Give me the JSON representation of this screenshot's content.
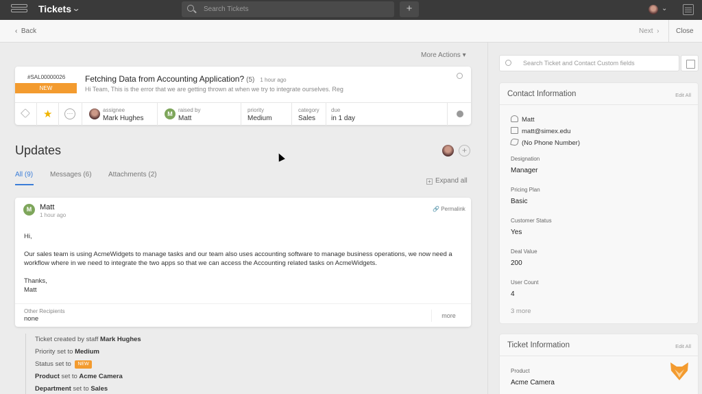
{
  "topbar": {
    "title": "Tickets",
    "search_placeholder": "Search Tickets",
    "add_label": "+"
  },
  "subnav": {
    "back": "Back",
    "next": "Next",
    "close": "Close"
  },
  "more_actions": "More Actions",
  "ticket": {
    "id": "#SAL00000026",
    "status": "NEW",
    "title": "Fetching Data from Accounting Application?",
    "count": "(5)",
    "time": "1 hour ago",
    "preview": "Hi Team, This is the error that we are getting thrown at when we try to integrate ourselves. Reg",
    "meta": {
      "assignee_label": "assignee",
      "assignee": "Mark Hughes",
      "raised_label": "raised by",
      "raised_initial": "M",
      "raised": "Matt",
      "priority_label": "priority",
      "priority": "Medium",
      "category_label": "category",
      "category": "Sales",
      "due_label": "due",
      "due": "in 1 day"
    }
  },
  "updates": {
    "title": "Updates",
    "tabs": [
      "All (9)",
      "Messages (6)",
      "Attachments (2)"
    ],
    "expand_all": "Expand all"
  },
  "message": {
    "initial": "M",
    "author": "Matt",
    "time": "1 hour ago",
    "permalink": "Permalink",
    "greeting": "Hi,",
    "body": "Our sales team is using AcmeWidgets to manage tasks and our team also uses accounting software to manage business operations, we now need a workflow where in we need to integrate the two apps so that we can access the Accounting related tasks on AcmeWidgets.",
    "signoff_1": "Thanks,",
    "signoff_2": "Matt",
    "recipients_label": "Other Recipients",
    "recipients": "none",
    "more": "more"
  },
  "activity": [
    {
      "prefix": "Ticket created by staff ",
      "bold": "Mark Hughes"
    },
    {
      "prefix": "Priority set to ",
      "bold": "Medium"
    },
    {
      "prefix": "Status set to ",
      "badge": "NEW"
    },
    {
      "bold_first": "Product",
      "prefix": " set to ",
      "bold": "Acme Camera"
    },
    {
      "bold_first": "Department",
      "prefix": " set to ",
      "bold": "Sales"
    }
  ],
  "right_panel": {
    "search_placeholder": "Search Ticket and Contact Custom fields",
    "contact": {
      "title": "Contact Information",
      "edit": "Edit All",
      "name": "Matt",
      "email": "matt@simex.edu",
      "phone": "(No Phone Number)",
      "fields": [
        {
          "label": "Designation",
          "value": "Manager"
        },
        {
          "label": "Pricing Plan",
          "value": "Basic"
        },
        {
          "label": "Customer Status",
          "value": "Yes"
        },
        {
          "label": "Deal Value",
          "value": "200"
        },
        {
          "label": "User Count",
          "value": "4"
        }
      ],
      "show_more": "3 more"
    },
    "ticket_info": {
      "title": "Ticket Information",
      "edit": "Edit All",
      "fields": [
        {
          "label": "Product",
          "value": "Acme Camera"
        }
      ]
    }
  },
  "colors": {
    "accent": "#3b7dd8",
    "status_new": "#f39b2f",
    "topbar": "#3a3a3a"
  }
}
